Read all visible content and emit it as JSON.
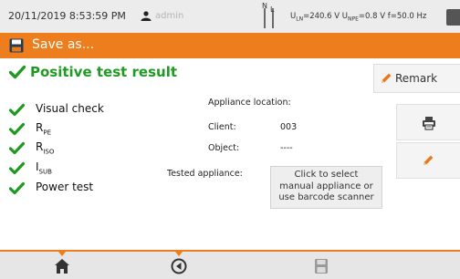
{
  "status_bar": {
    "datetime": "20/11/2019 8:53:59 PM",
    "user": "admin",
    "phase_n": "N",
    "phase_l": "L",
    "measurement": {
      "uln_label": "U",
      "uln_sub": "LN",
      "uln_value": "=240.6 V",
      "upe_label": "U",
      "upe_sub": "NPE",
      "upe_value": "=0.8 V",
      "freq": "f=50.0 Hz"
    }
  },
  "title_bar": {
    "title": "Save as...",
    "icon": "save-icon"
  },
  "result": {
    "title": "Positive test result",
    "icon": "check-icon",
    "color": "#1f9a22"
  },
  "remark_button": {
    "label": "Remark",
    "icon": "pencil-icon"
  },
  "checks": [
    {
      "label": "Visual check",
      "sub": ""
    },
    {
      "label": "R",
      "sub": "PE"
    },
    {
      "label": "R",
      "sub": "ISO"
    },
    {
      "label": "I",
      "sub": "SUB"
    },
    {
      "label": "Power test",
      "sub": ""
    }
  ],
  "details": {
    "appliance_location_label": "Appliance location:",
    "client_label": "Client:",
    "client_value": "003",
    "object_label": "Object:",
    "object_value": "----",
    "tested_appliance_label": "Tested appliance:",
    "select_button_lines": [
      "Click to select",
      "manual appliance or",
      "use barcode scanner"
    ]
  },
  "side_buttons": [
    {
      "icon": "printer-icon"
    },
    {
      "icon": "edit-pencil-icon"
    }
  ],
  "bottom_nav": [
    {
      "icon": "home-icon"
    },
    {
      "icon": "back-icon"
    },
    {
      "icon": "save-disk-icon"
    }
  ],
  "colors": {
    "accent": "#ee7d1e",
    "success": "#1f9a22",
    "edit": "#e8761a"
  }
}
